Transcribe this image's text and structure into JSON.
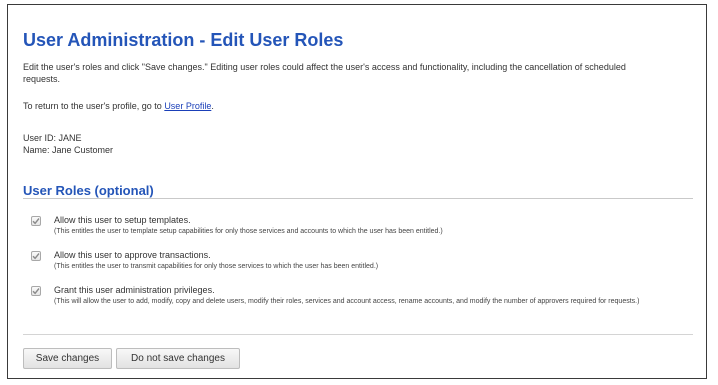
{
  "page": {
    "title": "User Administration - Edit User Roles",
    "intro": "Edit the user's roles and click \"Save changes.\" Editing user roles could affect the user's access and functionality, including the cancellation of scheduled requests.",
    "return_prefix": "To return to the user's profile, go to",
    "return_link": "User Profile",
    "return_suffix": "."
  },
  "user": {
    "id_line": "User ID: JANE",
    "name_line": "Name: Jane Customer"
  },
  "roles_section": {
    "title": "User Roles (optional)",
    "items": [
      {
        "label": "Allow this user to setup templates.",
        "description": "(This entitles the user to template setup capabilities for only those services and accounts to which the user has been entitled.)",
        "checked": true
      },
      {
        "label": "Allow this user to approve transactions.",
        "description": "(This entitles the user to transmit capabilities for only those services to which the user has been entitled.)",
        "checked": true
      },
      {
        "label": "Grant this user administration privileges.",
        "description": "(This will allow the user to add, modify, copy and delete users, modify their roles, services and account access, rename accounts, and modify the number of approvers required for requests.)",
        "checked": true
      }
    ]
  },
  "actions": {
    "save_label": "Save changes",
    "nosave_label": "Do not save changes"
  },
  "colors": {
    "heading": "#2455b8",
    "link": "#1a3fb8",
    "checkmark": "#8a8a8a"
  }
}
